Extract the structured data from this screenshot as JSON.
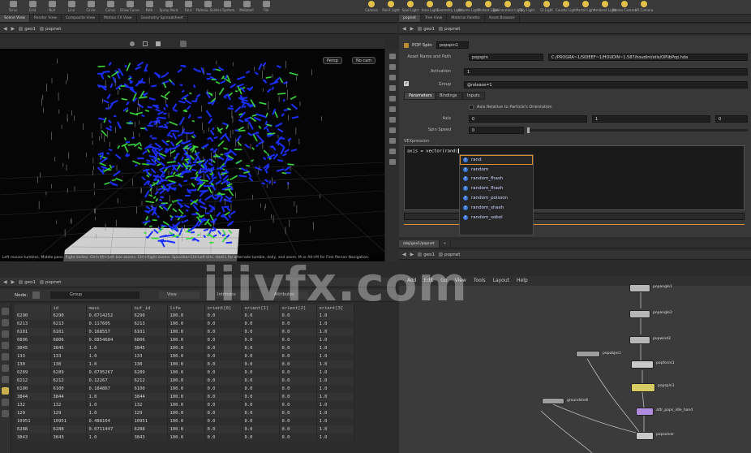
{
  "shelf": {
    "tools": [
      "Torus",
      "Grid",
      "Null",
      "Line",
      "Circle",
      "Curve",
      "Draw Curve",
      "Path",
      "Spray Paint",
      "Font",
      "Platonic Solids",
      "L-System",
      "Metaball",
      "File"
    ],
    "lights": [
      "Camera",
      "Point Light",
      "Spot Light",
      "Area Light",
      "Geometry Light",
      "Volume Light",
      "Distant Light",
      "Environment Light",
      "Sky Light",
      "GI Light",
      "Caustic Light",
      "Portal Light",
      "Ambient Light",
      "Stereo Camera",
      "VR Camera"
    ]
  },
  "viewport_tabs": [
    "Scene View",
    "Render View",
    "Composite View",
    "Motion FX View",
    "Geometry Spreadsheet"
  ],
  "param_tabs_top": [
    "popnet",
    "Tree View",
    "Material Palette",
    "Asset Browser"
  ],
  "viewport_path": {
    "node": "geo1",
    "child": "popnet"
  },
  "viewport": {
    "persp_label": "Persp",
    "cam_label": "No cam",
    "status": "Left mouse tumbles. Middle pans. Right dollies. Ctrl+Alt+Left box zooms. Ctrl+Right zooms. Spacebar-Ctrl-Left tilts. Hold L for alternate tumble, dolly, and zoom. M or Alt+M for First Person Navigation."
  },
  "params_path": {
    "node": "geo1",
    "child": "popnet"
  },
  "params": {
    "node_type": "POP Spin",
    "node_name": "popspin1",
    "asset_label": "Asset Name and Path",
    "asset_value": "popspin",
    "asset_path": "C:/PROGRA~1/SIDEEF~1/HOUDIN~1.587/houdini/otls/OPlibPop.hda",
    "activation_label": "Activation",
    "activation_value": "1",
    "group_label": "Group",
    "group_value": "@release=1",
    "tabs": [
      "Parameters",
      "Bindings",
      "Inputs"
    ],
    "axis_relative_label": "Axis Relative to Particle's Orientation",
    "axis_label": "Axis",
    "axis_values": [
      "0",
      "1",
      "0"
    ],
    "spin_speed_label": "Spin Speed",
    "spin_speed_value": "0",
    "vexpression_label": "VEXpression",
    "code": "axis = vector(rand(",
    "autocomplete": [
      "rand",
      "random",
      "random_fhash",
      "random_fhash",
      "random_poisson",
      "random_shash",
      "random_sobol"
    ]
  },
  "sheet_path": {
    "node": "geo1",
    "child": "popnet"
  },
  "sheet": {
    "node_label": "Node:",
    "group_label": "Group",
    "view_label": "View",
    "intrinsics_label": "Intrinsics",
    "attributes_label": "Attributes",
    "columns": [
      "",
      "id",
      "mass",
      "nuf_id",
      "life",
      "orient[0]",
      "orient[1]",
      "orient[2]",
      "orient[3]"
    ],
    "rows": [
      [
        "6290",
        "6290",
        "0.0714252",
        "6290",
        "100.0",
        "0.0",
        "0.0",
        "0.0",
        "1.0"
      ],
      [
        "6213",
        "6213",
        "0.117605",
        "6213",
        "100.0",
        "0.0",
        "0.0",
        "0.0",
        "1.0"
      ],
      [
        "6101",
        "6101",
        "0.168557",
        "6101",
        "100.0",
        "0.0",
        "0.0",
        "0.0",
        "1.0"
      ],
      [
        "6806",
        "6806",
        "0.0854684",
        "6806",
        "100.0",
        "0.0",
        "0.0",
        "0.0",
        "1.0"
      ],
      [
        "3845",
        "3845",
        "1.0",
        "3845",
        "100.0",
        "0.0",
        "0.0",
        "0.0",
        "1.0"
      ],
      [
        "133",
        "133",
        "1.0",
        "133",
        "100.0",
        "0.0",
        "0.0",
        "0.0",
        "1.0"
      ],
      [
        "130",
        "130",
        "1.0",
        "130",
        "100.0",
        "0.0",
        "0.0",
        "0.0",
        "1.0"
      ],
      [
        "6289",
        "6289",
        "0.0795267",
        "6289",
        "100.0",
        "0.0",
        "0.0",
        "0.0",
        "1.0"
      ],
      [
        "6212",
        "6212",
        "0.12267",
        "6212",
        "100.0",
        "0.0",
        "0.0",
        "0.0",
        "1.0"
      ],
      [
        "6100",
        "6100",
        "0.184867",
        "6100",
        "100.0",
        "0.0",
        "0.0",
        "0.0",
        "1.0"
      ],
      [
        "3844",
        "3844",
        "1.0",
        "3844",
        "100.0",
        "0.0",
        "0.0",
        "0.0",
        "1.0"
      ],
      [
        "132",
        "132",
        "1.0",
        "132",
        "100.0",
        "0.0",
        "0.0",
        "0.0",
        "1.0"
      ],
      [
        "129",
        "129",
        "1.0",
        "129",
        "100.0",
        "0.0",
        "0.0",
        "0.0",
        "1.0"
      ],
      [
        "10951",
        "10951",
        "0.488164",
        "10951",
        "100.0",
        "0.0",
        "0.0",
        "0.0",
        "1.0"
      ],
      [
        "6288",
        "6288",
        "0.0711447",
        "6288",
        "100.0",
        "0.0",
        "0.0",
        "0.0",
        "1.0"
      ],
      [
        "3843",
        "3843",
        "1.0",
        "3843",
        "100.0",
        "0.0",
        "0.0",
        "0.0",
        "1.0"
      ]
    ]
  },
  "network_tabs": [
    "/obj/geo1/popnet",
    "+"
  ],
  "network_path": {
    "node": "geo1",
    "child": "popnet"
  },
  "network": {
    "menu": [
      "Add",
      "Edit",
      "Go",
      "View",
      "Tools",
      "Layout",
      "Help"
    ],
    "nodes": [
      "popangle1",
      "popangle2",
      "popwind2",
      "popforce1",
      "popspin1",
      "popobject",
      "groundshell",
      "attr_pops_idle_hand",
      "popsolver"
    ]
  },
  "watermark": "iiivfx.com",
  "colors": {
    "particle_blue": "#1a2fff",
    "particle_green": "#39d93a",
    "accent_orange": "#d6902f",
    "node_yellow": "#d7cc63"
  }
}
